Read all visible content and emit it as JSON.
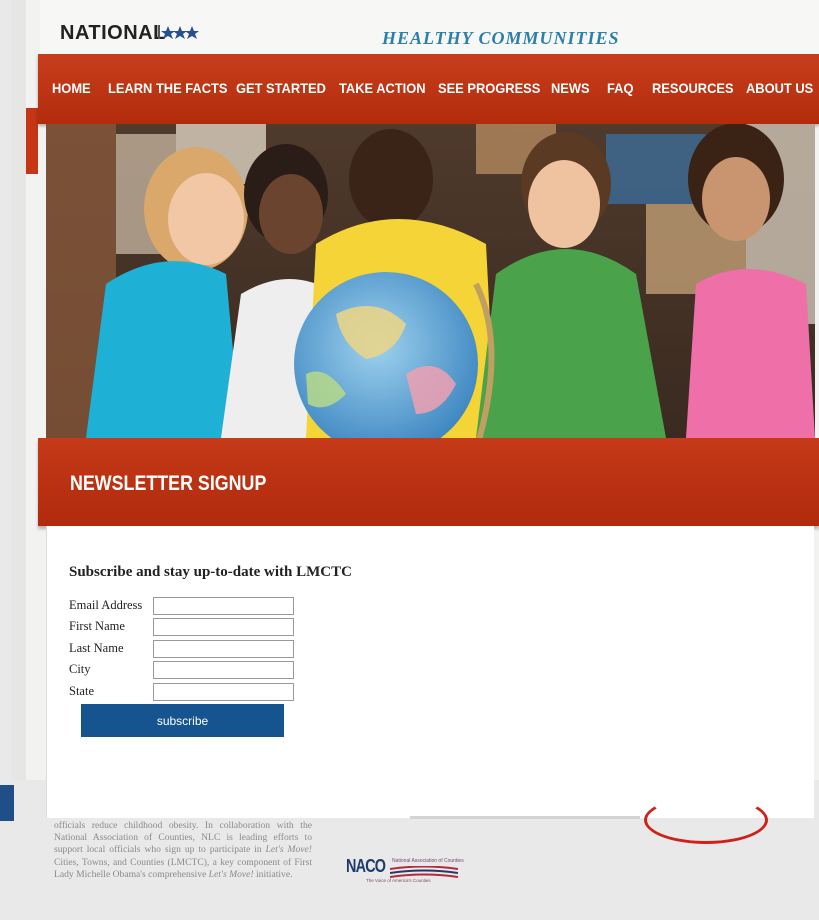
{
  "header": {
    "logo_text": "NATIONAL",
    "tagline": "HEALTHY COMMUNITIES"
  },
  "nav": {
    "items": [
      "HOME",
      "LEARN THE FACTS",
      "GET STARTED",
      "TAKE ACTION",
      "SEE PROGRESS",
      "NEWS",
      "FAQ",
      "RESOURCES",
      "ABOUT US"
    ]
  },
  "hero": {
    "image_alt": "Children gathered around a globe in a library"
  },
  "newsletter": {
    "title": "NEWSLETTER SIGNUP",
    "subtitle": "Subscribe and stay up-to-date with LMCTC",
    "fields": {
      "email_label": "Email Address",
      "email_value": "",
      "first_name_label": "First Name",
      "first_name_value": "",
      "last_name_label": "Last Name",
      "last_name_value": "",
      "city_label": "City",
      "city_value": "",
      "state_label": "State",
      "state_value": ""
    },
    "subscribe_label": "subscribe"
  },
  "footer": {
    "text_1": "officials reduce childhood obesity. In collaboration with the National Association of Counties, NLC is leading efforts to support local officials who sign up to participate in ",
    "text_em_1": "Let's Move!",
    "text_2": " Cities, Towns, and Counties (LMCTC), a key component of First Lady Michelle Obama's comprehensive ",
    "text_em_2": "Let's Move!",
    "text_3": " initiative.",
    "naco_logo_text": "NACO",
    "naco_small_text": "National Association of Counties",
    "naco_tagline": "The Voice of America's Counties"
  },
  "colors": {
    "brand_red": "#b8300f",
    "button_blue": "#15548e",
    "tagline_blue": "#2b7fa8"
  }
}
